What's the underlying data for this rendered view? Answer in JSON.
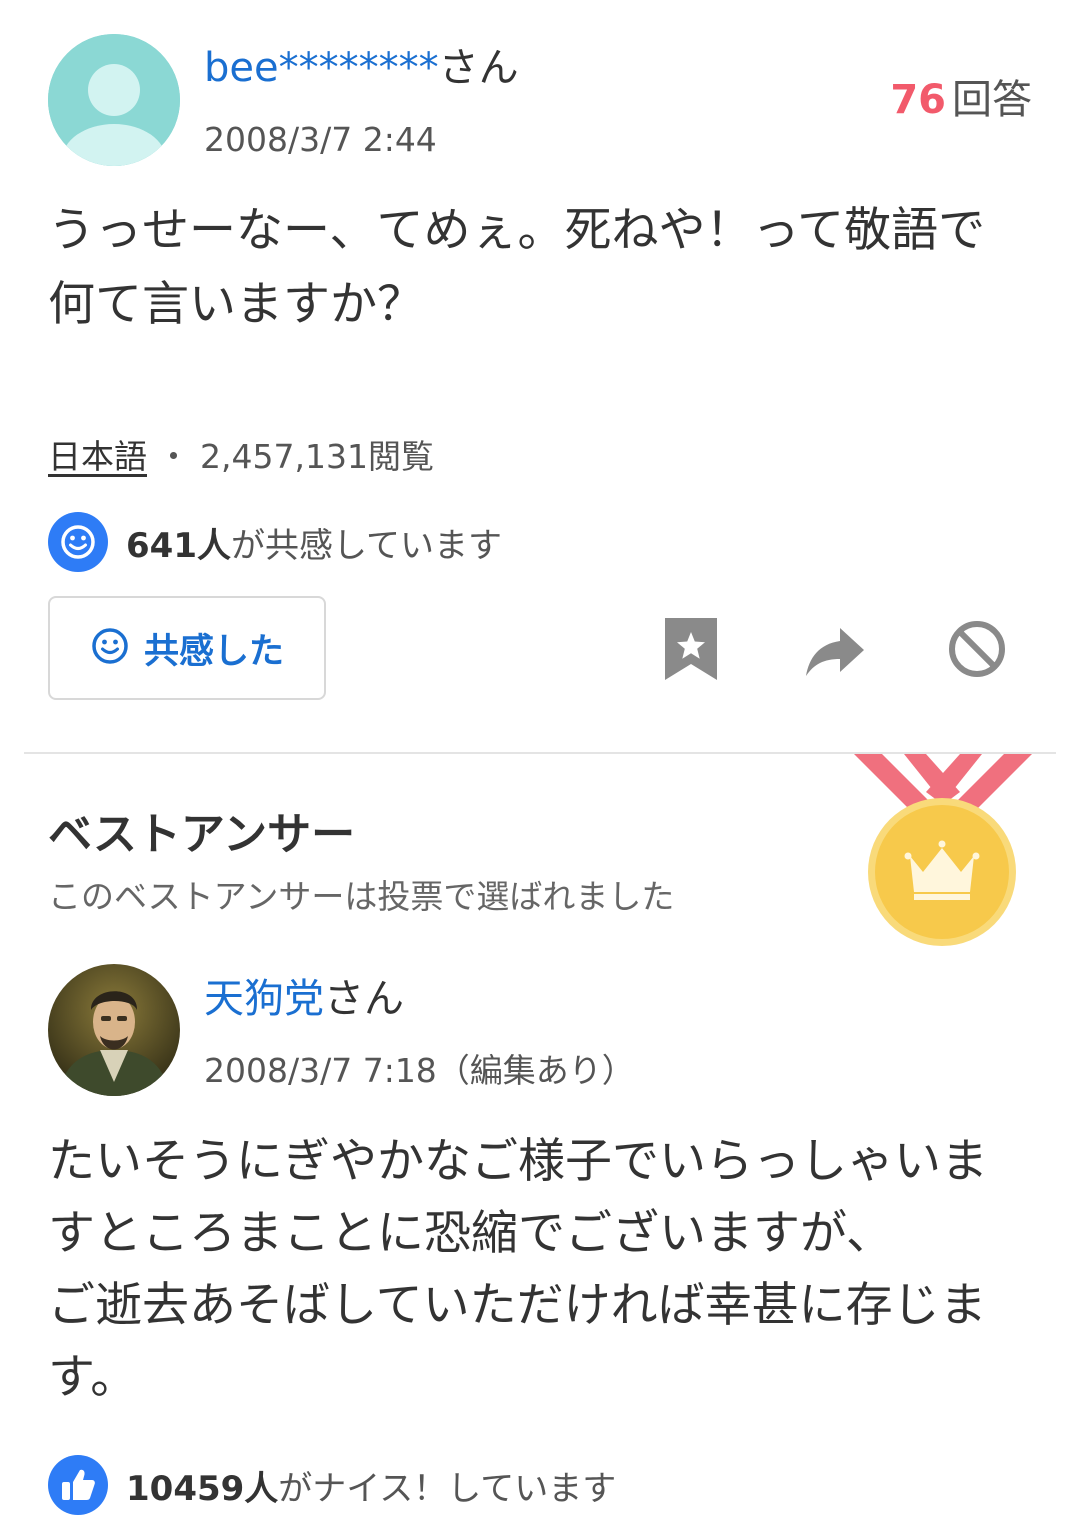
{
  "question": {
    "user_name": "bee********",
    "user_suffix": "さん",
    "date": "2008/3/7 2:44",
    "answer_count": "76",
    "answer_unit": "回答",
    "body": "うっせーなー、てめぇ。死ねや！って敬語で何て言いますか？",
    "category": "日本語",
    "separator": "・",
    "views": "2,457,131閲覧",
    "empathy_count": "641人",
    "empathy_text": "が共感しています",
    "empathy_button_label": "共感した"
  },
  "best_answer": {
    "title": "ベストアンサー",
    "subtitle": "このベストアンサーは投票で選ばれました",
    "user_name": "天狗党",
    "user_suffix": "さん",
    "date": "2008/3/7 7:18（編集あり）",
    "body_lines": [
      "たいそうにぎやかなご様子でいらっしゃいますところまことに恐縮でございますが、",
      "ご逝去あそばしていただければ幸甚に存じます。"
    ],
    "nice_count": "10459人",
    "nice_text": "がナイス！しています"
  },
  "icons": {
    "question_avatar": "default-user-avatar-icon",
    "empathy_badge": "smile-icon",
    "bookmark": "bookmark-star-icon",
    "share": "share-arrow-icon",
    "block": "block-icon",
    "medal": "crown-medal-icon",
    "nice_badge": "thumbs-up-icon"
  },
  "colors": {
    "link_blue": "#1a6fd1",
    "badge_blue": "#2e7cf6",
    "answer_count_red": "#f25a6b",
    "medal_gold": "#f7c94b",
    "ribbon_red": "#f0707e",
    "avatar_teal": "#8bd8d4"
  }
}
